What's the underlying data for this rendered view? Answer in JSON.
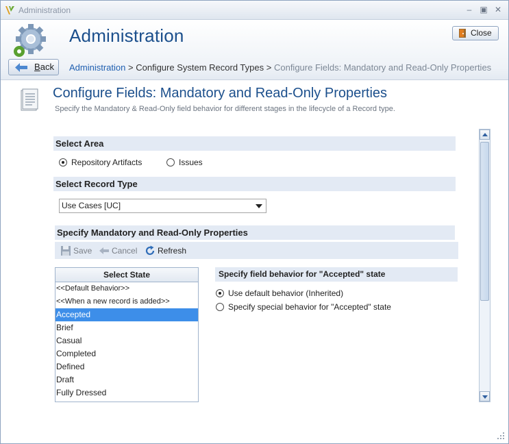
{
  "window": {
    "title": "Administration"
  },
  "header": {
    "title": "Administration",
    "close_label": "Close",
    "back_label_prefix": "",
    "back_label_mnemonic": "B",
    "back_label_rest": "ack"
  },
  "breadcrumb": {
    "items": [
      "Administration",
      "Configure System Record Types",
      "Configure Fields: Mandatory and Read-Only Properties"
    ],
    "separator": ">"
  },
  "section": {
    "title": "Configure Fields: Mandatory and Read-Only Properties",
    "description": "Specify the Mandatory & Read-Only field behavior for different stages in the lifecycle of a Record type."
  },
  "select_area": {
    "heading": "Select Area",
    "options": [
      {
        "label": "Repository Artifacts",
        "selected": true
      },
      {
        "label": "Issues",
        "selected": false
      }
    ]
  },
  "select_record_type": {
    "heading": "Select Record Type",
    "value": "Use Cases [UC]"
  },
  "properties": {
    "heading": "Specify Mandatory and Read-Only Properties",
    "toolbar": {
      "save_label": "Save",
      "cancel_label": "Cancel",
      "refresh_label": "Refresh"
    }
  },
  "states": {
    "heading": "Select State",
    "items": [
      "<<Default Behavior>>",
      "<<When a new record is added>>",
      "Accepted",
      "Brief",
      "Casual",
      "Completed",
      "Defined",
      "Draft",
      "Fully Dressed"
    ],
    "selected_index": 2
  },
  "behavior": {
    "heading": "Specify field behavior for \"Accepted\" state",
    "options": [
      {
        "label": "Use default behavior (Inherited)",
        "selected": true
      },
      {
        "label": "Specify special behavior for \"Accepted\" state",
        "selected": false
      }
    ]
  },
  "colors": {
    "accent": "#1b4f8c",
    "selection": "#3d8ee9",
    "band": "#e3eaf4"
  },
  "icons": [
    "app-logo-icon",
    "gear-icon",
    "door-icon",
    "back-arrow-icon",
    "document-icon",
    "save-icon",
    "cancel-icon",
    "refresh-icon"
  ]
}
